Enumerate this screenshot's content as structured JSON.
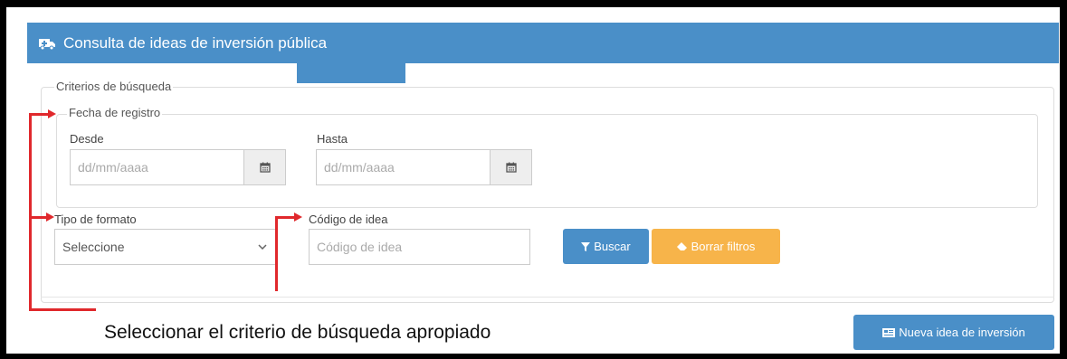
{
  "panel": {
    "title": "Consulta de ideas de inversión pública",
    "icon": "ambulance-icon"
  },
  "criteria": {
    "legend": "Criterios de búsqueda",
    "date_group": {
      "legend": "Fecha de registro",
      "from_label": "Desde",
      "from_placeholder": "dd/mm/aaaa",
      "to_label": "Hasta",
      "to_placeholder": "dd/mm/aaaa"
    },
    "format_label": "Tipo de formato",
    "format_selected": "Seleccione",
    "code_label": "Código de idea",
    "code_placeholder": "Código de idea"
  },
  "buttons": {
    "search": "Buscar",
    "clear": "Borrar filtros",
    "new_idea": "Nueva idea de inversión"
  },
  "annotation": {
    "caption": "Seleccionar el criterio de búsqueda apropiado"
  },
  "colors": {
    "header": "#4a8fc8",
    "primary": "#4a8fc8",
    "warning": "#f7b44a",
    "annotation": "#e0282c"
  }
}
